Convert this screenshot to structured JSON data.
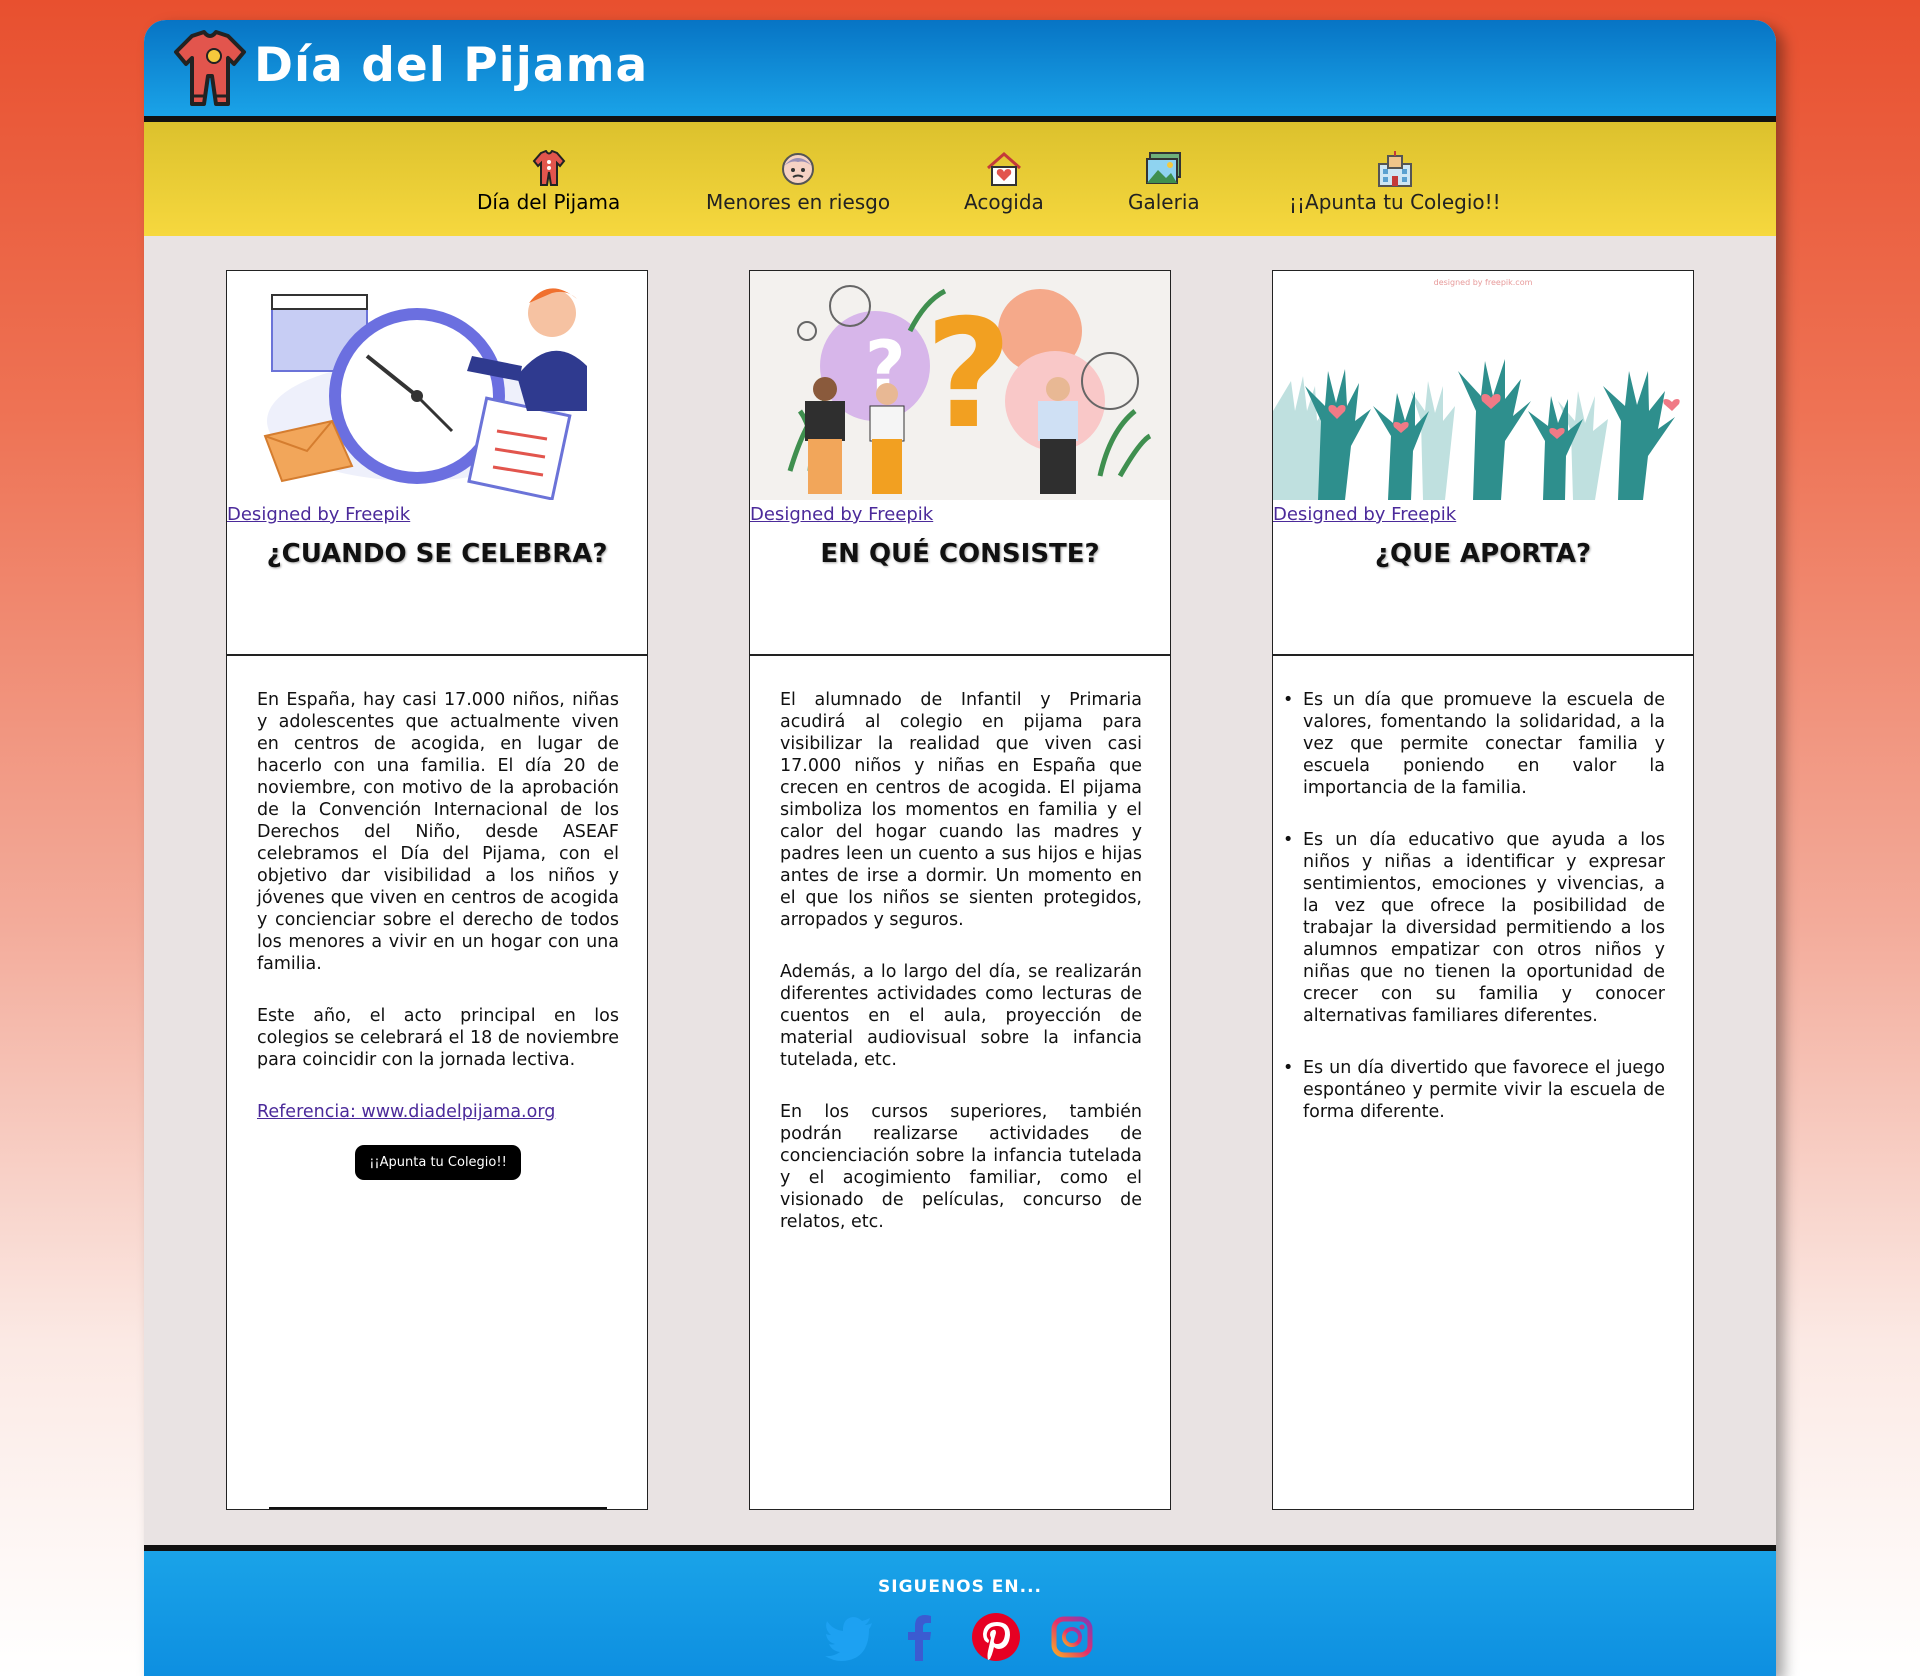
{
  "header": {
    "title": "Día del Pijama",
    "logo_icon": "pajama-logo-icon"
  },
  "nav": {
    "items": [
      {
        "label": "Día del Pijama",
        "icon": "pajama-icon"
      },
      {
        "label": "Menores en riesgo",
        "icon": "child-face-icon"
      },
      {
        "label": "Acogida",
        "icon": "heart-house-icon"
      },
      {
        "label": "Galeria",
        "icon": "photo-gallery-icon"
      },
      {
        "label": "¡¡Apunta tu Colegio!!",
        "icon": "school-building-icon"
      }
    ]
  },
  "cards": [
    {
      "image": "clock-calendar-illustration",
      "credit": "Designed by Freepik",
      "title": "¿CUANDO SE CELEBRA?",
      "paragraphs": [
        "En España, hay casi 17.000 niños, niñas y adolescentes que actualmente viven en centros de acogida, en lugar de hacerlo con una familia. El día 20 de noviembre, con motivo de la aprobación de la Convención Internacional de los Derechos del Niño, desde ASEAF celebramos el Día del Pijama, con el objetivo dar visibilidad a los niños y jóvenes que viven en centros de acogida y concienciar sobre el derecho de todos los menores a vivir en un hogar con una familia.",
        "Este año, el acto principal en los colegios se celebrará el 18 de noviembre para coincidir con la jornada lectiva."
      ],
      "link": "Referencia: www.diadelpijama.org",
      "button": "¡¡Apunta tu Colegio!!"
    },
    {
      "image": "question-marks-people-illustration",
      "credit": "Designed by Freepik",
      "title": "EN QUÉ CONSISTE?",
      "paragraphs": [
        "El alumnado de Infantil y Primaria acudirá al colegio en pijama para visibilizar la realidad que viven casi 17.000 niños y niñas en España que crecen en centros de acogida. El pijama simboliza los momentos en familia y el calor del hogar cuando las madres y padres leen un cuento a sus hijos e hijas antes de irse a dormir. Un momento en el que los niños se sienten protegidos, arropados y seguros.",
        "Además, a lo largo del día, se realizarán diferentes actividades como lecturas de cuentos en el aula, proyección de material audiovisual sobre la infancia tutelada, etc.",
        "En los cursos superiores, también podrán realizarse actividades de concienciación sobre la infancia tutelada y el acogimiento familiar, como el visionado de películas, concurso de relatos, etc."
      ]
    },
    {
      "image": "raised-hands-hearts-illustration",
      "image_watermark": "designed by freepik.com",
      "credit": "Designed by Freepik",
      "title": "¿QUE APORTA?",
      "bullets": [
        "Es un día que promueve la escuela de valores, fomentando la solidaridad, a la vez que permite conectar familia y escuela poniendo en valor la importancia de la familia.",
        "Es un día educativo que ayuda a los niños y niñas a identificar y expresar sentimientos, emociones y vivencias, a la vez que ofrece la posibilidad de trabajar la diversidad permitiendo a los alumnos empatizar con otros niños y niñas que no tienen la oportunidad de crecer con su familia y conocer alternativas familiares diferentes.",
        "Es un día divertido que favorece el juego espontáneo y permite vivir la escuela de forma diferente."
      ]
    }
  ],
  "footer": {
    "title": "SIGUENOS EN...",
    "social": [
      "twitter-icon",
      "facebook-icon",
      "pinterest-icon",
      "instagram-icon"
    ]
  },
  "colors": {
    "header_blue": "#0774c4",
    "nav_yellow": "#f6d83e",
    "page_bg": "#e9e3e3",
    "background_orange": "#e8502f",
    "button_black": "#000000",
    "link_purple": "#4b2a9a"
  }
}
